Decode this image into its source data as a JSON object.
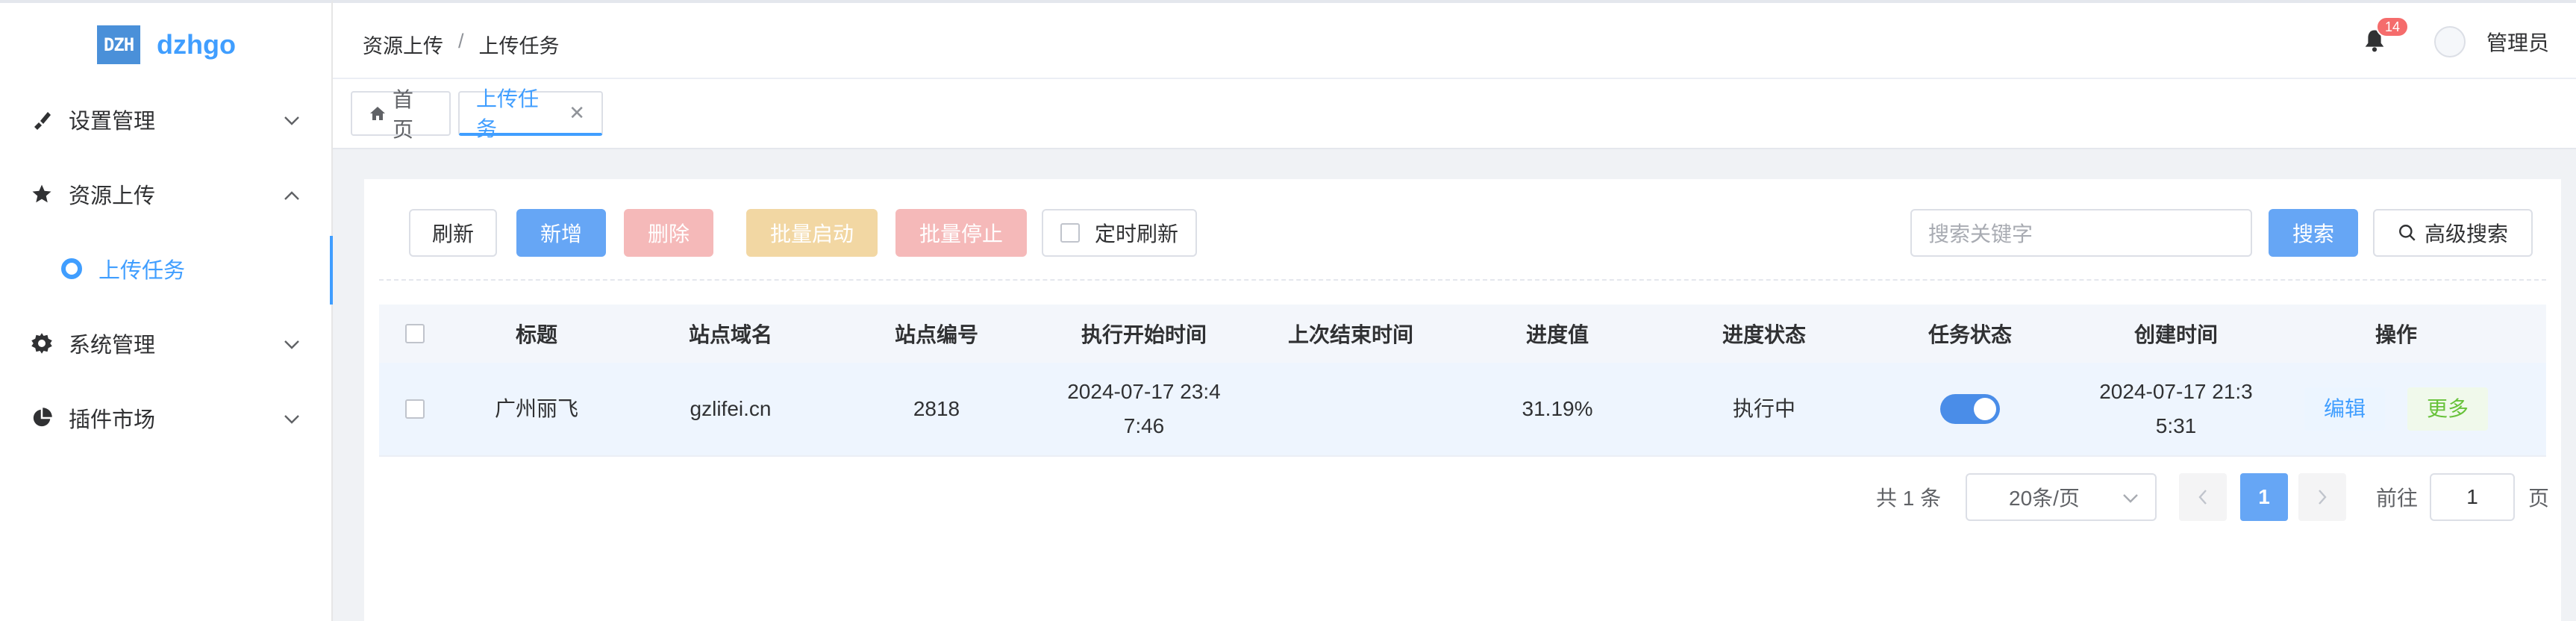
{
  "app": {
    "logo_mark": "DZH",
    "logo_text": "dzhgo"
  },
  "sidebar": {
    "items": [
      {
        "label": "设置管理",
        "icon": "brush-icon",
        "expanded": false
      },
      {
        "label": "资源上传",
        "icon": "star-icon",
        "expanded": true
      },
      {
        "label": "上传任务",
        "icon": "circle-dot-icon",
        "active": true
      },
      {
        "label": "系统管理",
        "icon": "gear-icon",
        "expanded": false
      },
      {
        "label": "插件市场",
        "icon": "pie-icon",
        "expanded": false
      }
    ]
  },
  "header": {
    "breadcrumb": [
      "资源上传",
      "上传任务"
    ],
    "notification_count": "14",
    "user_name": "管理员"
  },
  "tabs": [
    {
      "label": "首页",
      "icon": "home-icon"
    },
    {
      "label": "上传任务",
      "active": true,
      "closable": true
    }
  ],
  "toolbar": {
    "refresh": "刷新",
    "add": "新增",
    "delete": "删除",
    "batch_start": "批量启动",
    "batch_stop": "批量停止",
    "timed_refresh": "定时刷新",
    "search_placeholder": "搜索关键字",
    "search": "搜索",
    "advanced_search": "高级搜索"
  },
  "table": {
    "columns": [
      "标题",
      "站点域名",
      "站点编号",
      "执行开始时间",
      "上次结束时间",
      "进度值",
      "进度状态",
      "任务状态",
      "创建时间",
      "操作"
    ],
    "rows": [
      {
        "title": "广州丽飞",
        "domain": "gzlifei.cn",
        "site_no": "2818",
        "start_time_line1": "2024-07-17 23:4",
        "start_time_line2": "7:46",
        "last_end_time": "",
        "progress": "31.19%",
        "progress_status": "执行中",
        "task_enabled": true,
        "created_line1": "2024-07-17 21:3",
        "created_line2": "5:31",
        "edit": "编辑",
        "more": "更多"
      }
    ]
  },
  "pagination": {
    "total_text": "共 1 条",
    "page_size": "20条/页",
    "current_page": "1",
    "goto_label": "前往",
    "goto_value": "1",
    "page_suffix": "页"
  },
  "colors": {
    "primary": "#409eff",
    "danger": "#f56c6c",
    "success": "#67c23a"
  }
}
